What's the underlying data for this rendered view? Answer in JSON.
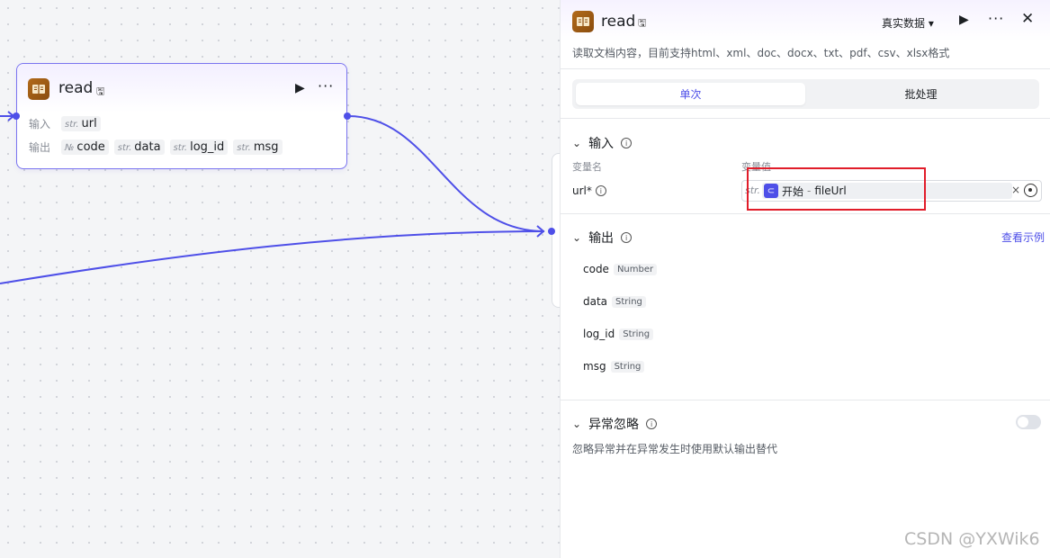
{
  "canvas_node": {
    "title": "read",
    "input_label": "输入",
    "output_label": "输出",
    "inputs": [
      {
        "type": "str.",
        "name": "url"
      }
    ],
    "outputs": [
      {
        "type": "№",
        "name": "code"
      },
      {
        "type": "str.",
        "name": "data"
      },
      {
        "type": "str.",
        "name": "log_id"
      },
      {
        "type": "str.",
        "name": "msg"
      }
    ]
  },
  "panel": {
    "title": "read",
    "data_mode": "真实数据 ▾",
    "description": "读取文档内容，目前支持html、xml、doc、docx、txt、pdf、csv、xlsx格式",
    "tabs": {
      "single": "单次",
      "batch": "批处理"
    },
    "input_section": {
      "title": "输入",
      "col_name": "变量名",
      "col_value": "变量值",
      "url_label": "url*",
      "url_type": "str.",
      "ref_source": "开始",
      "ref_sep": "-",
      "ref_field": "fileUrl"
    },
    "output_section": {
      "title": "输出",
      "example_link": "查看示例",
      "fields": [
        {
          "name": "code",
          "type": "Number"
        },
        {
          "name": "data",
          "type": "String"
        },
        {
          "name": "log_id",
          "type": "String"
        },
        {
          "name": "msg",
          "type": "String"
        }
      ]
    },
    "error_section": {
      "title": "异常忽略",
      "description": "忽略异常并在异常发生时使用默认输出替代",
      "enabled": false
    }
  },
  "watermark": "CSDN @YXWik6",
  "colors": {
    "accent": "#4e4fe8",
    "highlight": "#e11d2a"
  }
}
